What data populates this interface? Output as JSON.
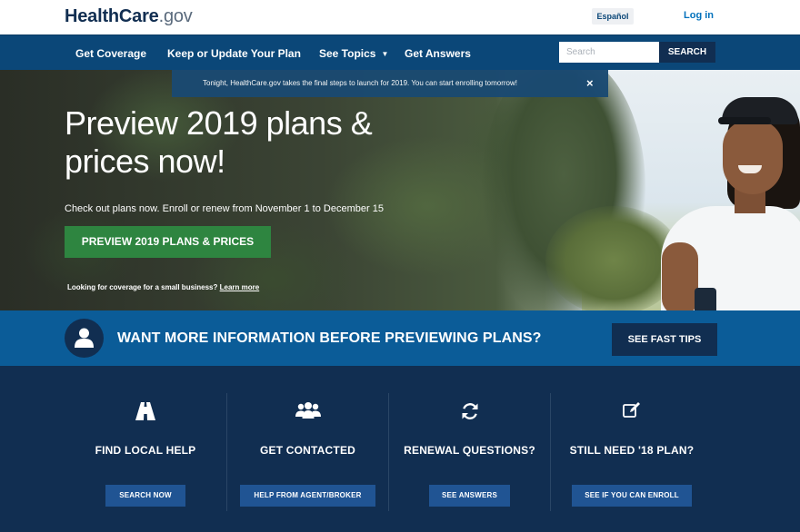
{
  "header": {
    "logo_brand": "HealthCare",
    "logo_tld": ".gov",
    "language_label": "Español",
    "login_label": "Log in"
  },
  "nav": {
    "items": [
      {
        "label": "Get Coverage"
      },
      {
        "label": "Keep or Update Your Plan"
      },
      {
        "label": "See Topics",
        "has_dropdown": true
      },
      {
        "label": "Get Answers"
      }
    ],
    "search_placeholder": "Search",
    "search_button": "SEARCH"
  },
  "alert": {
    "text": "Tonight, HealthCare.gov takes the final steps to launch for 2019. You can start enrolling tomorrow!",
    "close_symbol": "×"
  },
  "hero": {
    "title": "Preview 2019 plans & prices now!",
    "subtitle": "Check out plans now. Enroll or renew from November 1 to December 15",
    "cta_label": "PREVIEW 2019 PLANS & PRICES",
    "small_text": "Looking for coverage for a small business?",
    "small_link": "Learn more"
  },
  "info_strip": {
    "text": "WANT MORE INFORMATION BEFORE PREVIEWING PLANS?",
    "button_label": "SEE FAST TIPS"
  },
  "features": [
    {
      "icon": "road-icon",
      "title": "FIND LOCAL HELP",
      "button": "SEARCH NOW"
    },
    {
      "icon": "group-icon",
      "title": "GET CONTACTED",
      "button": "HELP FROM AGENT/BROKER"
    },
    {
      "icon": "refresh-icon",
      "title": "RENEWAL QUESTIONS?",
      "button": "SEE ANSWERS"
    },
    {
      "icon": "edit-icon",
      "title": "STILL NEED '18 PLAN?",
      "button": "SEE IF YOU CAN ENROLL"
    }
  ],
  "colors": {
    "navy": "#112e51",
    "nav_blue": "#0b4778",
    "strip_blue": "#0b5c98",
    "cta_green": "#2e8540",
    "button_blue": "#205493"
  }
}
